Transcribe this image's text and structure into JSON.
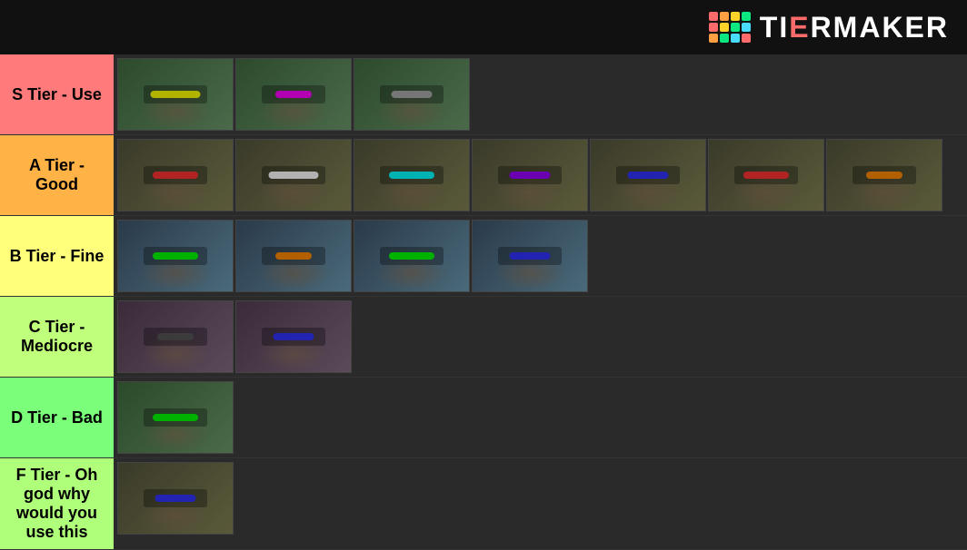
{
  "header": {
    "logo_text": "TiERMAKER",
    "logo_dots": [
      {
        "color": "#ff6b6b"
      },
      {
        "color": "#ff9f43"
      },
      {
        "color": "#ffd32a"
      },
      {
        "color": "#0be881"
      },
      {
        "color": "#ff6b6b"
      },
      {
        "color": "#ffd32a"
      },
      {
        "color": "#0be881"
      },
      {
        "color": "#48dbfb"
      },
      {
        "color": "#ff9f43"
      },
      {
        "color": "#0be881"
      },
      {
        "color": "#48dbfb"
      },
      {
        "color": "#ff6b6b"
      }
    ]
  },
  "tiers": [
    {
      "id": "s",
      "label": "S Tier - Use",
      "color": "#ff7b7b",
      "items": [
        {
          "color": "#ffff00",
          "type": "yellow"
        },
        {
          "color": "#ff00ff",
          "type": "pink"
        },
        {
          "color": "#888888",
          "type": "gray"
        }
      ]
    },
    {
      "id": "a",
      "label": "A Tier - Good",
      "color": "#ffb347",
      "items": [
        {
          "color": "#ff3333",
          "type": "red"
        },
        {
          "color": "#ffffff",
          "type": "white"
        },
        {
          "color": "#00ffff",
          "type": "cyan"
        },
        {
          "color": "#9900ff",
          "type": "purple"
        },
        {
          "color": "#3333ff",
          "type": "blue"
        },
        {
          "color": "#ff3333",
          "type": "red2"
        },
        {
          "color": "#ff6600",
          "type": "orange"
        }
      ]
    },
    {
      "id": "b",
      "label": "B Tier - Fine",
      "color": "#ffff7b",
      "items": [
        {
          "color": "#00ff00",
          "type": "green"
        },
        {
          "color": "#ff8800",
          "type": "orange"
        },
        {
          "color": "#00ff00",
          "type": "green2"
        },
        {
          "color": "#3333ff",
          "type": "blue"
        }
      ]
    },
    {
      "id": "c",
      "label": "C Tier -\nMediocre",
      "color": "#bfff7b",
      "items": [
        {
          "color": "#333333",
          "type": "dark"
        },
        {
          "color": "#0000ff",
          "type": "blue"
        }
      ]
    },
    {
      "id": "d",
      "label": "D Tier - Bad",
      "color": "#7bff7b",
      "items": [
        {
          "color": "#00ff00",
          "type": "green"
        }
      ]
    },
    {
      "id": "f",
      "label": "F Tier - Oh god why would you use this",
      "color": "#b0ff7b",
      "items": [
        {
          "color": "#0000ff",
          "type": "blue"
        }
      ]
    }
  ]
}
